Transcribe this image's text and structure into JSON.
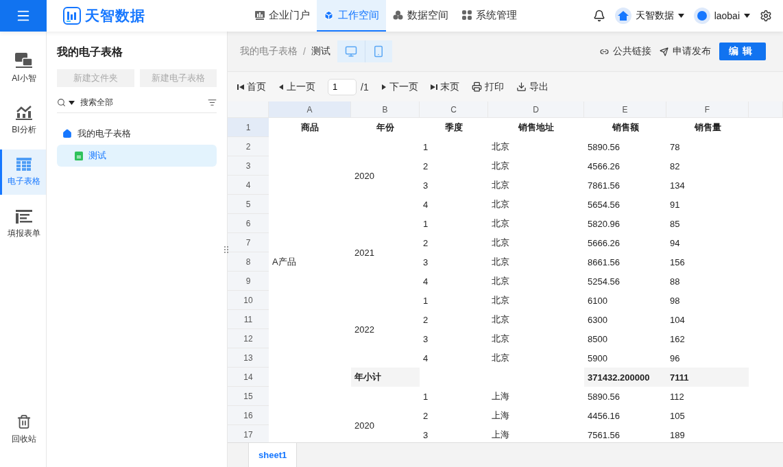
{
  "topbar": {
    "logo": "天智数据",
    "nav": [
      {
        "label": "企业门户",
        "kind": "portal",
        "selected": false
      },
      {
        "label": "工作空间",
        "kind": "workspace",
        "selected": true
      },
      {
        "label": "数据空间",
        "kind": "data",
        "selected": false
      },
      {
        "label": "系统管理",
        "kind": "admin",
        "selected": false
      }
    ],
    "org": "天智数据",
    "user": "laobai"
  },
  "rail": [
    {
      "label": "AI小智",
      "kind": "ai",
      "selected": false
    },
    {
      "label": "BI分析",
      "kind": "bi",
      "selected": false
    },
    {
      "label": "电子表格",
      "kind": "sheet",
      "selected": true
    },
    {
      "label": "填报表单",
      "kind": "form",
      "selected": false
    },
    {
      "label": "回收站",
      "kind": "trash",
      "selected": false
    }
  ],
  "panel": {
    "title": "我的电子表格",
    "buttons": [
      "新建文件夹",
      "新建电子表格"
    ],
    "search": {
      "scope": "搜索全部"
    },
    "tree": [
      {
        "label": "我的电子表格",
        "kind": "root",
        "selected": false,
        "children": [
          {
            "label": "测试",
            "kind": "sheet",
            "selected": true
          }
        ]
      }
    ]
  },
  "main": {
    "breadcrumb": [
      "我的电子表格",
      "测试"
    ],
    "breadcrumb_separator": "/",
    "view_modes": [
      {
        "kind": "desktop"
      },
      {
        "kind": "mobile"
      }
    ],
    "actions": [
      {
        "label": "公共链接",
        "kind": "link"
      },
      {
        "label": "申请发布",
        "kind": "publish"
      }
    ],
    "edit_button": "编辑"
  },
  "toolbar": [
    {
      "kind": "first",
      "label": "首页"
    },
    {
      "kind": "prev",
      "label": "上一页"
    },
    {
      "kind": "page",
      "value": "1",
      "total": "/1"
    },
    {
      "kind": "next",
      "label": "下一页"
    },
    {
      "kind": "last",
      "label": "末页"
    },
    {
      "kind": "print",
      "label": "打印"
    },
    {
      "kind": "export",
      "label": "导出"
    }
  ],
  "sheet": {
    "columns": [
      {
        "label": "A",
        "selected": true
      },
      {
        "label": "B",
        "selected": false
      },
      {
        "label": "C",
        "selected": false
      },
      {
        "label": "D",
        "selected": false
      },
      {
        "label": "E",
        "selected": false
      },
      {
        "label": "F",
        "selected": false
      }
    ],
    "rows": [
      {
        "label": "1",
        "selected": true
      },
      {
        "label": "2",
        "selected": false
      },
      {
        "label": "3",
        "selected": false
      },
      {
        "label": "4",
        "selected": false
      },
      {
        "label": "5",
        "selected": false
      },
      {
        "label": "6",
        "selected": false
      },
      {
        "label": "7",
        "selected": false
      },
      {
        "label": "8",
        "selected": false
      },
      {
        "label": "9",
        "selected": false
      },
      {
        "label": "10",
        "selected": false
      },
      {
        "label": "11",
        "selected": false
      },
      {
        "label": "12",
        "selected": false
      },
      {
        "label": "13",
        "selected": false
      },
      {
        "label": "14",
        "selected": false
      },
      {
        "label": "15",
        "selected": false
      },
      {
        "label": "16",
        "selected": false
      },
      {
        "label": "17",
        "selected": false
      }
    ],
    "headers": [
      "商品",
      "年份",
      "季度",
      "销售地址",
      "销售额",
      "销售量"
    ],
    "products": [
      {
        "name": "A产品",
        "years": [
          {
            "year": "2020",
            "cut_off": false,
            "quarters": [
              {
                "quarter": "1",
                "city": "北京",
                "amount": "5890.56",
                "qty": "78"
              },
              {
                "quarter": "2",
                "city": "北京",
                "amount": "4566.26",
                "qty": "82"
              },
              {
                "quarter": "3",
                "city": "北京",
                "amount": "7861.56",
                "qty": "134"
              },
              {
                "quarter": "4",
                "city": "北京",
                "amount": "5654.56",
                "qty": "91"
              }
            ]
          },
          {
            "year": "2021",
            "cut_off": false,
            "quarters": [
              {
                "quarter": "1",
                "city": "北京",
                "amount": "5820.96",
                "qty": "85"
              },
              {
                "quarter": "2",
                "city": "北京",
                "amount": "5666.26",
                "qty": "94"
              },
              {
                "quarter": "3",
                "city": "北京",
                "amount": "8661.56",
                "qty": "156"
              },
              {
                "quarter": "4",
                "city": "北京",
                "amount": "5254.56",
                "qty": "88"
              }
            ]
          },
          {
            "year": "2022",
            "cut_off": false,
            "quarters": [
              {
                "quarter": "1",
                "city": "北京",
                "amount": "6100",
                "qty": "98"
              },
              {
                "quarter": "2",
                "city": "北京",
                "amount": "6300",
                "qty": "104"
              },
              {
                "quarter": "3",
                "city": "北京",
                "amount": "8500",
                "qty": "162"
              },
              {
                "quarter": "4",
                "city": "北京",
                "amount": "5900",
                "qty": "96"
              }
            ]
          }
        ],
        "subtotal": {
          "label": "年小计",
          "amount": "371432.200000",
          "qty": "7111"
        }
      },
      {
        "years": [
          {
            "year": "2020",
            "cut_off": true,
            "quarters": [
              {
                "quarter": "1",
                "city": "上海",
                "amount": "5890.56",
                "qty": "112"
              },
              {
                "quarter": "2",
                "city": "上海",
                "amount": "4456.16",
                "qty": "105"
              },
              {
                "quarter": "3",
                "city": "上海",
                "amount": "7561.56",
                "qty": "189"
              }
            ]
          }
        ]
      }
    ]
  },
  "tabs": [
    {
      "label": "sheet1",
      "selected": true
    }
  ]
}
